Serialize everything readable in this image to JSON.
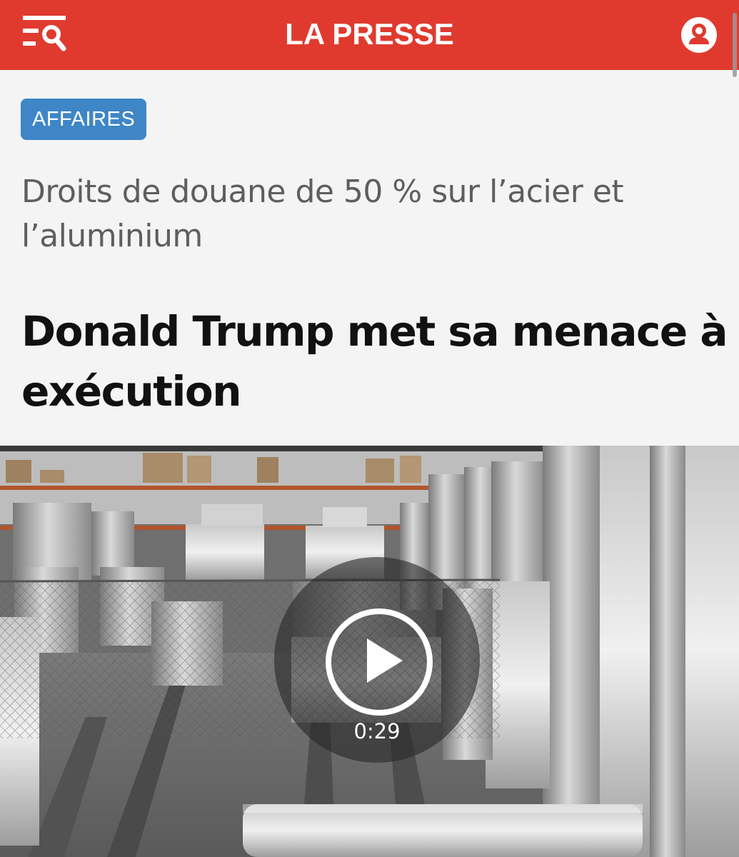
{
  "header": {
    "logo": "LA PRESSE",
    "menu_icon": "menu-search-icon",
    "account_icon": "user-account-icon",
    "brand_color": "#e03a2f"
  },
  "article": {
    "category": "AFFAIRES",
    "category_color": "#3e86c6",
    "kicker": "Droits de douane de 50 % sur l’acier et l’aluminium",
    "headline": "Donald Trump met sa menace à exécution"
  },
  "video": {
    "play_icon": "play-icon",
    "duration": "0:29"
  }
}
